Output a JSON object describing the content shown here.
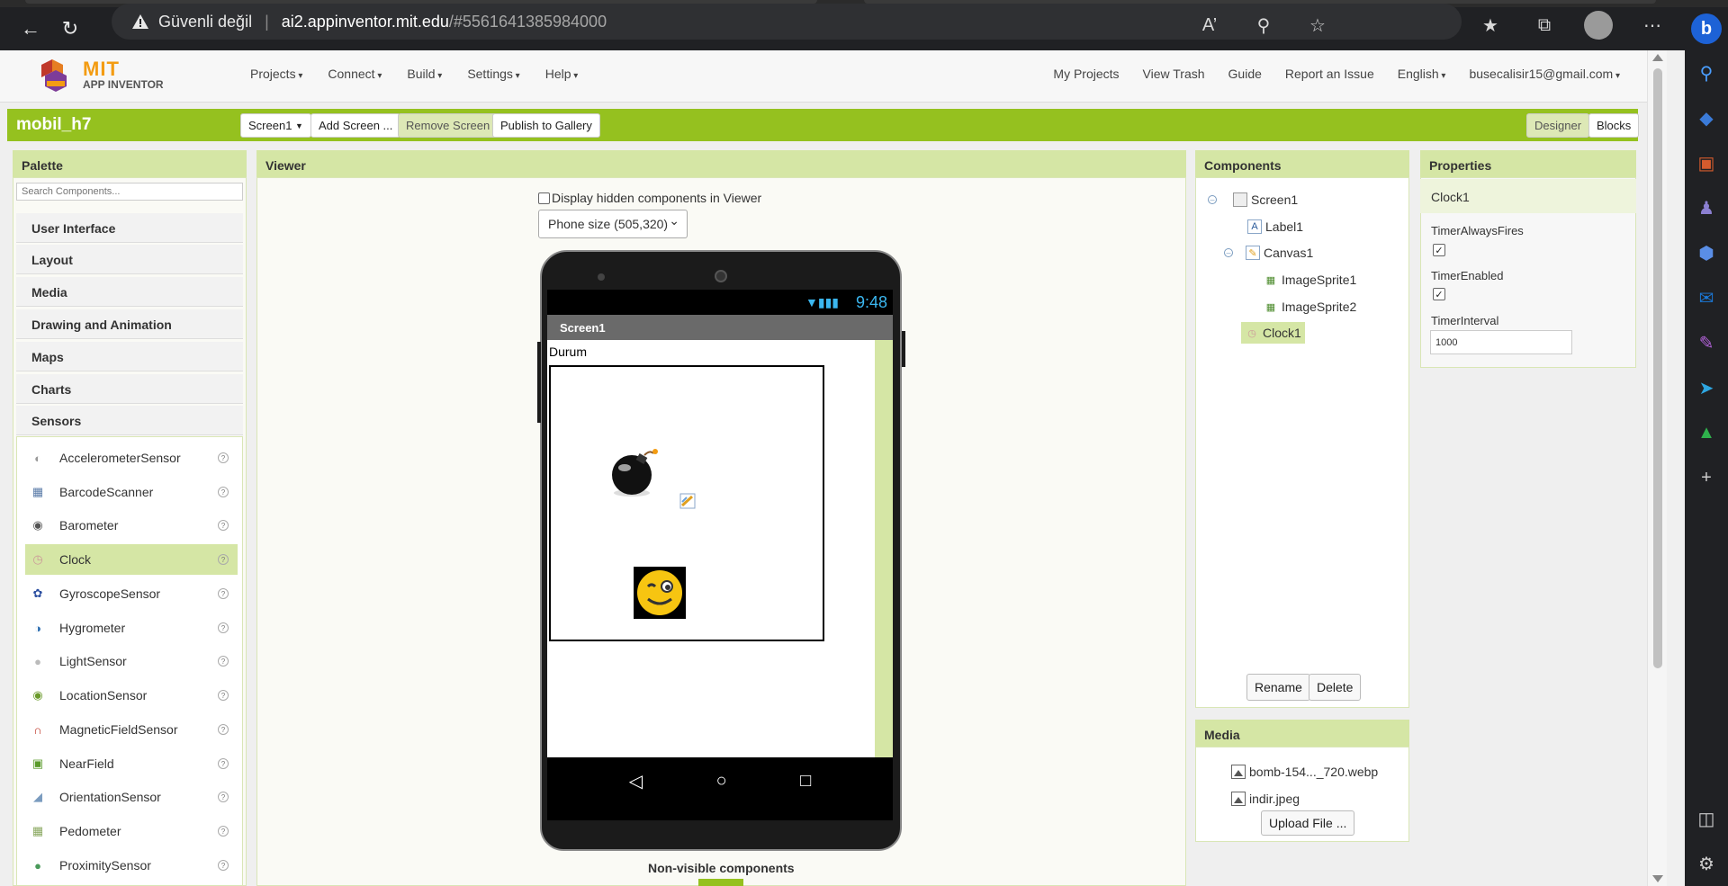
{
  "browser": {
    "security_label": "Güvenli değil",
    "url_host": "ai2.appinventor.mit.edu",
    "url_path": "/#5561641385984000"
  },
  "app": {
    "logo_text": "MIT",
    "logo_subtext": "APP INVENTOR",
    "menu": [
      "Projects",
      "Connect",
      "Build",
      "Settings",
      "Help"
    ],
    "right_menu": {
      "my_projects": "My Projects",
      "view_trash": "View Trash",
      "guide": "Guide",
      "report_issue": "Report an Issue",
      "language": "English",
      "account": "busecalisir15@gmail.com"
    }
  },
  "project": {
    "name": "mobil_h7",
    "screen_select": "Screen1",
    "add_screen": "Add Screen ...",
    "remove_screen": "Remove Screen",
    "publish": "Publish to Gallery",
    "designer": "Designer",
    "blocks": "Blocks"
  },
  "palette": {
    "title": "Palette",
    "search_placeholder": "Search Components...",
    "categories": [
      "User Interface",
      "Layout",
      "Media",
      "Drawing and Animation",
      "Maps",
      "Charts",
      "Sensors"
    ],
    "items": [
      "AccelerometerSensor",
      "BarcodeScanner",
      "Barometer",
      "Clock",
      "GyroscopeSensor",
      "Hygrometer",
      "LightSensor",
      "LocationSensor",
      "MagneticFieldSensor",
      "NearField",
      "OrientationSensor",
      "Pedometer",
      "ProximitySensor"
    ],
    "selected_item": "Clock"
  },
  "viewer": {
    "title": "Viewer",
    "hidden_checkbox_label": "Display hidden components in Viewer",
    "size_select": "Phone size (505,320)",
    "phone_time": "9:48",
    "screen_title": "Screen1",
    "label_text": "Durum",
    "nonvisible_label": "Non-visible components"
  },
  "components": {
    "title": "Components",
    "tree": [
      "Screen1",
      "Label1",
      "Canvas1",
      "ImageSprite1",
      "ImageSprite2",
      "Clock1"
    ],
    "selected": "Clock1",
    "rename": "Rename",
    "delete": "Delete"
  },
  "media": {
    "title": "Media",
    "files": [
      "bomb-154..._720.webp",
      "indir.jpeg"
    ],
    "upload": "Upload File ..."
  },
  "properties": {
    "title": "Properties",
    "component": "Clock1",
    "timer_always_fires_label": "TimerAlwaysFires",
    "timer_always_fires": true,
    "timer_enabled_label": "TimerEnabled",
    "timer_enabled": true,
    "timer_interval_label": "TimerInterval",
    "timer_interval": "1000"
  },
  "colors": {
    "accent_green": "#95c11f",
    "header_green": "#d5e6a5"
  }
}
